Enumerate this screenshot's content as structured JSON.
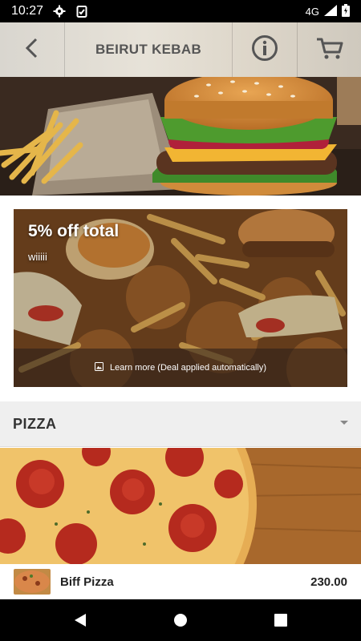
{
  "status_bar": {
    "time": "10:27",
    "network": "4G",
    "icons": [
      "settings-icon",
      "clipboard-check-icon",
      "signal-icon",
      "battery-icon"
    ]
  },
  "header": {
    "title": "BEIRUT KEBAB",
    "icons": [
      "back-chevron-icon",
      "info-icon",
      "cart-icon"
    ]
  },
  "hero": {
    "image": "burger-and-fries-photo"
  },
  "deal": {
    "title": "5% off total",
    "subtitle": "wiiiii",
    "footer_text": "Learn more (Deal applied automatically)",
    "image": "fast-food-platter-photo"
  },
  "section": {
    "title": "PIZZA",
    "icon": "dropdown-caret-icon"
  },
  "section_image": "pepperoni-pizza-photo",
  "items": [
    {
      "name": "Biff Pizza",
      "price": "230.00"
    }
  ],
  "navbar": {
    "icons": [
      "back-triangle-icon",
      "home-circle-icon",
      "recents-square-icon"
    ]
  },
  "colors": {
    "header_bg": "#e3ded4",
    "section_bg": "#efefef",
    "status_bg": "#000000"
  }
}
